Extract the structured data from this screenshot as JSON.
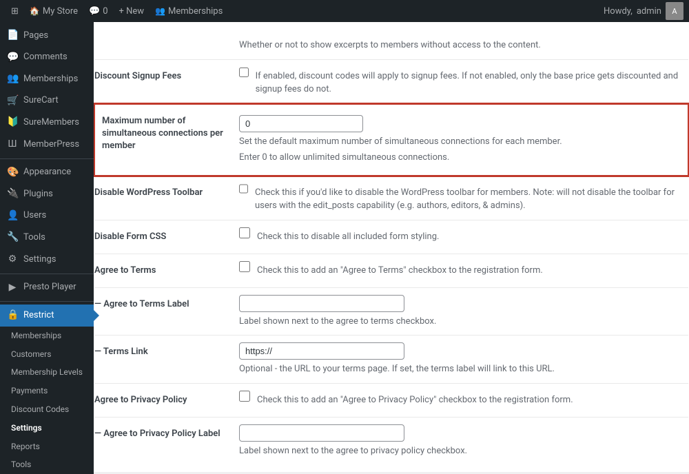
{
  "adminbar": {
    "store_icon": "⊞",
    "store_name": "My Store",
    "comments_icon": "💬",
    "comments_count": "0",
    "new_label": "+ New",
    "memberships_label": "Memberships",
    "howdy_label": "Howdy,",
    "admin_label": "admin"
  },
  "sidebar": {
    "pages_label": "Pages",
    "comments_label": "Comments",
    "memberships_label": "Memberships",
    "surecart_label": "SureCart",
    "suremembers_label": "SureMembers",
    "memberpress_label": "MemberPress",
    "appearance_label": "Appearance",
    "plugins_label": "Plugins",
    "users_label": "Users",
    "tools_label": "Tools",
    "settings_label": "Settings",
    "presto_label": "Presto Player",
    "restrict_label": "Restrict",
    "submenu": {
      "memberships": "Memberships",
      "customers": "Customers",
      "membership_levels": "Membership Levels",
      "payments": "Payments",
      "discount_codes": "Discount Codes",
      "settings": "Settings",
      "reports": "Reports",
      "tools": "Tools"
    }
  },
  "content": {
    "excerpt_label": "",
    "excerpt_desc": "Whether or not to show excerpts to members without access to the content.",
    "discount_label": "Discount Signup Fees",
    "discount_desc": "If enabled, discount codes will apply to signup fees. If not enabled, only the base price gets discounted and signup fees do not.",
    "max_connections_label": "Maximum number of simultaneous connections per member",
    "max_connections_value": "0",
    "max_connections_desc1": "Set the default maximum number of simultaneous connections for each member.",
    "max_connections_desc2": "Enter 0 to allow unlimited simultaneous connections.",
    "toolbar_label": "Disable WordPress Toolbar",
    "toolbar_desc": "Check this if you'd like to disable the WordPress toolbar for members. Note: will not disable the toolbar for users with the edit_posts capability (e.g. authors, editors, & admins).",
    "formcss_label": "Disable Form CSS",
    "formcss_desc": "Check this to disable all included form styling.",
    "agree_terms_label": "Agree to Terms",
    "agree_terms_desc": "Check this to add an \"Agree to Terms\" checkbox to the registration form.",
    "agree_terms_field_label": "— Agree to Terms Label",
    "agree_terms_field_desc": "Label shown next to the agree to terms checkbox.",
    "terms_link_label": "— Terms Link",
    "terms_link_value": "https://",
    "terms_link_desc": "Optional - the URL to your terms page. If set, the terms label will link to this URL.",
    "privacy_policy_label": "Agree to Privacy Policy",
    "privacy_policy_desc": "Check this to add an \"Agree to Privacy Policy\" checkbox to the registration form.",
    "privacy_policy_field_label": "— Agree to Privacy Policy Label",
    "privacy_policy_field_desc": "Label shown next to the agree to privacy policy checkbox."
  }
}
